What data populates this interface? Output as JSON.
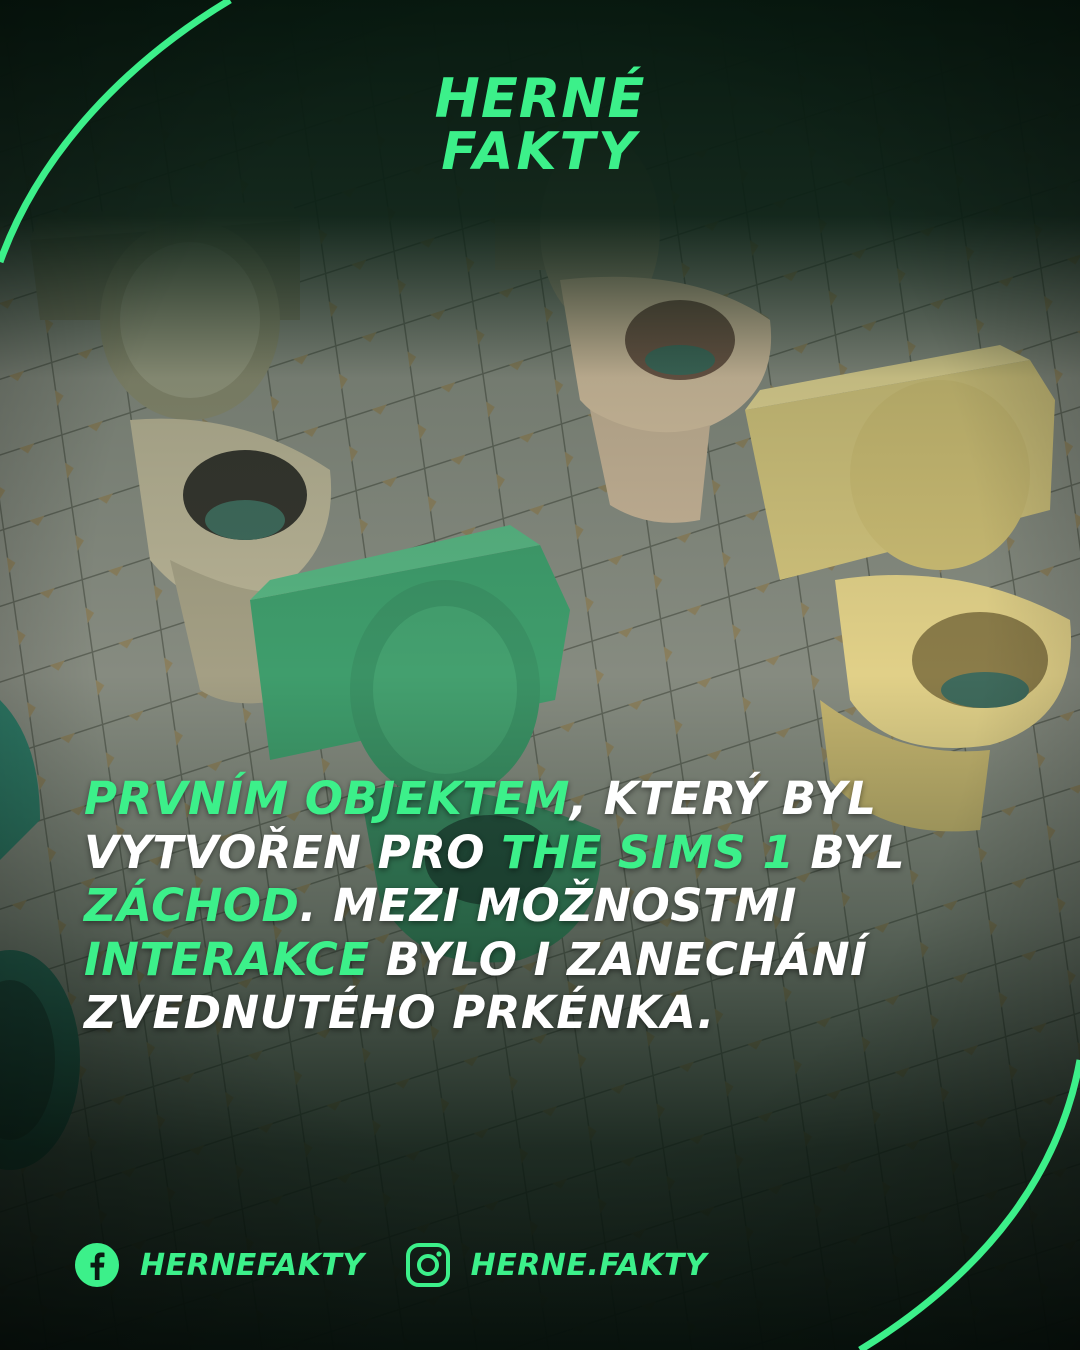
{
  "brand": {
    "line1": "HERNÉ",
    "line2": "FAKTY",
    "accent_color": "#3cf08a"
  },
  "background": {
    "subject": "toilets on tiled floor",
    "overlay_color": "#0d2a1c"
  },
  "fact": [
    {
      "text": "PRVNÍM OBJEKTEM",
      "highlight": true
    },
    {
      "text": ", KTERÝ BYL VYTVOŘEN PRO ",
      "highlight": false
    },
    {
      "text": "THE SIMS 1",
      "highlight": true
    },
    {
      "text": " BYL ",
      "highlight": false
    },
    {
      "text": "ZÁCHOD",
      "highlight": true
    },
    {
      "text": ". MEZI MOŽNOSTMI ",
      "highlight": false
    },
    {
      "text": "INTERAKCE",
      "highlight": true
    },
    {
      "text": " BYLO I ZANECHÁNÍ ZVEDNUTÉHO PRKÉNKA.",
      "highlight": false
    }
  ],
  "social": {
    "facebook": {
      "icon": "facebook-icon",
      "handle": "HERNEFAKTY"
    },
    "instagram": {
      "icon": "instagram-icon",
      "handle": "HERNE.FAKTY"
    }
  }
}
